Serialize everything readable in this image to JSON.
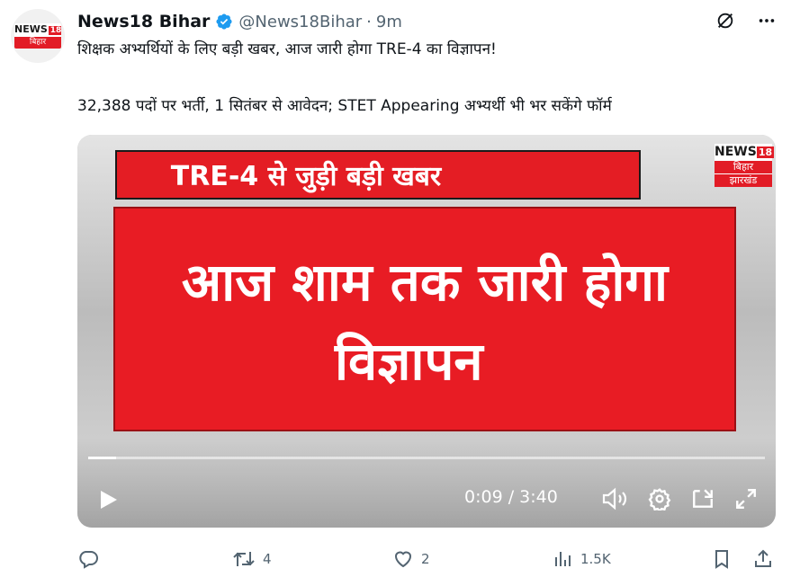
{
  "tweet": {
    "author_name": "News18 Bihar",
    "handle": "@News18Bihar",
    "separator": "·",
    "time": "9m",
    "text_line1": "शिक्षक अभ्यर्थियों के लिए बड़ी खबर, आज जारी होगा TRE-4 का विज्ञापन!",
    "text_line2": "32,388 पदों पर भर्ती, 1 सितंबर से आवेदन; STET Appearing अभ्यर्थी भी भर सकेंगे फॉर्म"
  },
  "avatar": {
    "logo_word": "NEWS",
    "logo_num": "18",
    "logo_sub": "बिहार"
  },
  "video": {
    "headline_top": "TRE-4 से जुड़ी बड़ी खबर",
    "headline_main_line1": "आज शाम तक जारी होगा",
    "headline_main_line2": "विज्ञापन",
    "channel_logo_word": "NEWS",
    "channel_logo_num": "18",
    "channel_logo_line1": "बिहार",
    "channel_logo_line2": "झारखंड",
    "elapsed": "0:09",
    "duration": "3:40",
    "time_display": "0:09 / 3:40",
    "progress_fraction": 0.041
  },
  "actions": {
    "replies": "",
    "reposts": "4",
    "likes": "2",
    "views": "1.5K"
  },
  "colors": {
    "brand_red": "#e41d24",
    "verified_blue": "#1d9bf0",
    "muted_text": "#536471"
  },
  "icons": [
    "verified-badge-icon",
    "grok-icon",
    "more-icon",
    "play-icon",
    "volume-icon",
    "settings-icon",
    "pip-icon",
    "fullscreen-icon",
    "reply-icon",
    "repost-icon",
    "like-icon",
    "views-icon",
    "bookmark-icon",
    "share-icon"
  ]
}
